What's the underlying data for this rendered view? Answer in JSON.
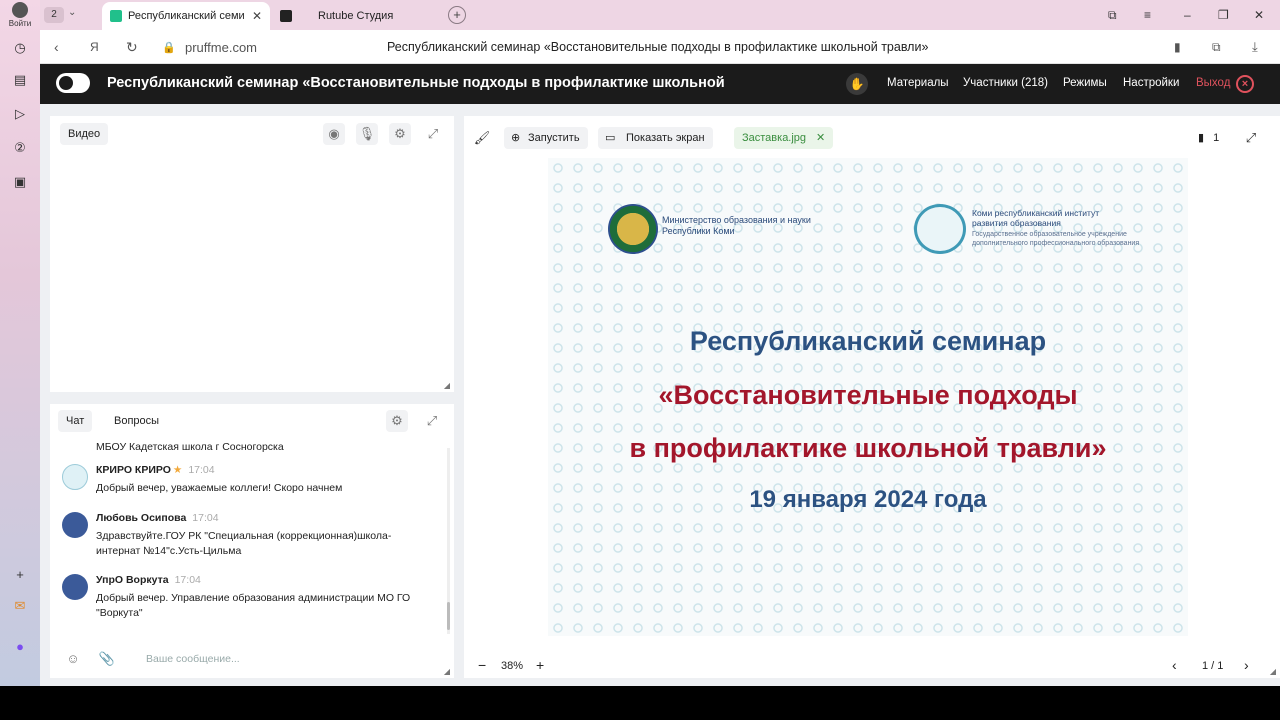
{
  "browser": {
    "login_label": "Войти",
    "tab_count": "2",
    "tabs": [
      {
        "title": "Республиканский семи",
        "active": true
      },
      {
        "title": "Rutube Студия",
        "active": false
      }
    ],
    "domain": "pruffme.com",
    "page_title": "Республиканский семинар «Восстановительные подходы в профилактике школьной травли»"
  },
  "header": {
    "title": "Республиканский семинар «Восстановительные подходы в профилактике школьной",
    "menu": {
      "materials": "Материалы",
      "participants": "Участники (218)",
      "modes": "Режимы",
      "settings": "Настройки",
      "exit": "Выход"
    }
  },
  "video_panel": {
    "label": "Видео"
  },
  "chat_panel": {
    "tabs": [
      "Чат",
      "Вопросы"
    ],
    "messages": [
      {
        "name": "",
        "time": "",
        "text": "МБОУ Кадетская школа г Сосногорска"
      },
      {
        "name": "КРИРО КРИРО",
        "time": "17:04",
        "text": "Добрый вечер, уважаемые коллеги! Скоро начнем"
      },
      {
        "name": "Любовь Осипова",
        "time": "17:04",
        "text": "Здравствуйте.ГОУ РК \"Специальная (коррекционная)школа-интернат №14\"с.Усть-Цильма"
      },
      {
        "name": "УпрО Воркута",
        "time": "17:04",
        "text": "Добрый вечер. Управление образования администрации МО ГО \"Воркута\""
      }
    ],
    "input_placeholder": "Ваше сообщение..."
  },
  "slide_panel": {
    "toolbar": {
      "launch": "Запустить",
      "share_screen": "Показать экран",
      "file_name": "Заставка.jpg",
      "bookmarks_count": "1"
    },
    "zoom": "38%",
    "page": "1 / 1",
    "slide": {
      "org_left": "Министерство образования  и науки\nРеспублики Коми",
      "org_right": "Коми республиканский институт\nразвития образования",
      "org_right_sub": "Государственное образовательное учреждение\nдополнительного профессионального образования",
      "line1": "Республиканский семинар",
      "line2": "«Восстановительные подходы",
      "line3": "в профилактике школьной травли»",
      "date": "19 января 2024 года"
    }
  },
  "colors": {
    "header_bg": "#1b1b1b",
    "exit_red": "#e0525d",
    "slide_blue": "#2c5282",
    "slide_red": "#a3162b",
    "file_green": "#3a8e3f"
  }
}
